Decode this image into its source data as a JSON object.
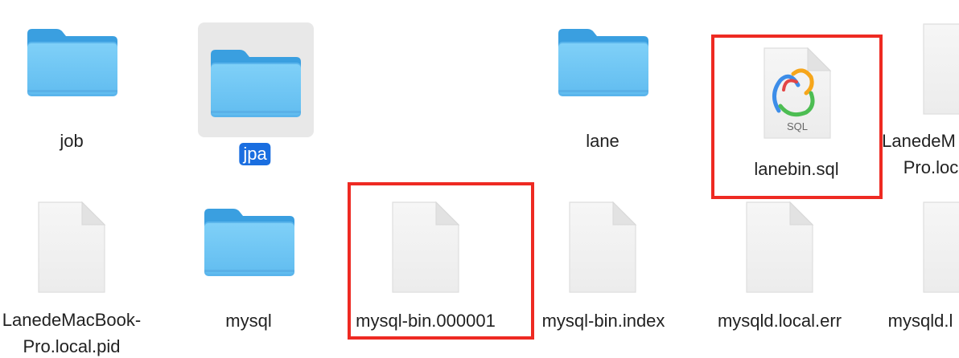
{
  "files": [
    {
      "name": "job",
      "kind": "folder",
      "selected": false
    },
    {
      "name": "jpa",
      "kind": "folder",
      "selected": true
    },
    {
      "name": "lane",
      "kind": "folder",
      "selected": false
    },
    {
      "name": "lanebin.sql",
      "kind": "sql",
      "icon_text": "SQL",
      "selected": false
    },
    {
      "name": "LanedeM",
      "name_line2": "Pro.loc",
      "kind": "document",
      "selected": false
    },
    {
      "name": "LanedeMacBook-",
      "name_line2": "Pro.local.pid",
      "kind": "document",
      "selected": false
    },
    {
      "name": "mysql",
      "kind": "folder",
      "selected": false
    },
    {
      "name": "mysql-bin.000001",
      "kind": "document",
      "selected": false
    },
    {
      "name": "mysql-bin.index",
      "kind": "document",
      "selected": false
    },
    {
      "name": "mysqld.local.err",
      "kind": "document",
      "selected": false
    },
    {
      "name": "mysqld.l",
      "kind": "document",
      "selected": false
    }
  ],
  "colors": {
    "folder_front": "#6cc6f5",
    "folder_back": "#3aa0e2",
    "selection": "#1a6ee0",
    "highlight_box": "#ee2a22"
  }
}
